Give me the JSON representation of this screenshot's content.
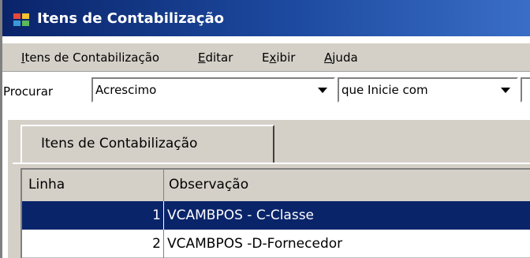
{
  "window": {
    "title": "Itens de Contabilização",
    "icon": "app-blocks-icon"
  },
  "menu": [
    {
      "label": "Itens de Contabilização",
      "mnemonic": "I"
    },
    {
      "label": "Editar",
      "mnemonic": "E"
    },
    {
      "label": "Exibir",
      "mnemonic": "x"
    },
    {
      "label": "Ajuda",
      "mnemonic": "A"
    }
  ],
  "search": {
    "label": "Procurar",
    "field_value": "Acrescimo",
    "condition_value": "que Inicie com"
  },
  "tabs": [
    {
      "label": "Itens de Contabilização",
      "active": true
    }
  ],
  "grid": {
    "columns": [
      "Linha",
      "Observação"
    ],
    "rows": [
      {
        "linha": "1",
        "observacao": "VCAMBPOS - C-Classe",
        "selected": true
      },
      {
        "linha": "2",
        "observacao": "VCAMBPOS -D-Fornecedor",
        "selected": false
      }
    ]
  },
  "colors": {
    "title_bar": "#0a246a",
    "selection": "#0a246a",
    "face": "#d4d0c8"
  }
}
